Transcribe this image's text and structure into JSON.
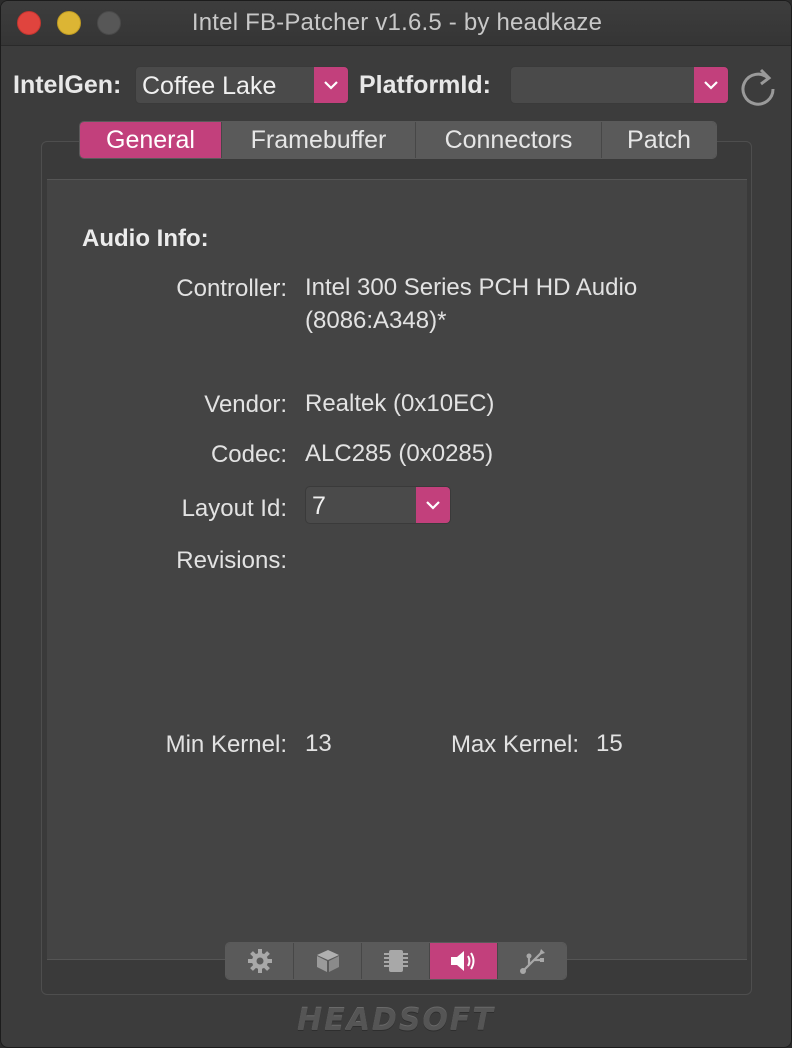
{
  "window": {
    "title": "Intel FB-Patcher v1.6.5 - by headkaze"
  },
  "toolbar": {
    "intelgen_label": "IntelGen:",
    "intelgen_value": "Coffee Lake",
    "platformid_label": "PlatformId:",
    "platformid_value": ""
  },
  "tabs": [
    {
      "label": "General",
      "active": true
    },
    {
      "label": "Framebuffer",
      "active": false
    },
    {
      "label": "Connectors",
      "active": false
    },
    {
      "label": "Patch",
      "active": false
    }
  ],
  "audio": {
    "heading": "Audio Info:",
    "controller_label": "Controller:",
    "controller_value_line1": "Intel 300 Series PCH HD Audio",
    "controller_value_line2": "(8086:A348)*",
    "vendor_label": "Vendor:",
    "vendor_value": "Realtek (0x10EC)",
    "codec_label": "Codec:",
    "codec_value": "ALC285 (0x0285)",
    "layout_label": "Layout Id:",
    "layout_value": "7",
    "revisions_label": "Revisions:",
    "min_kernel_label": "Min Kernel:",
    "min_kernel_value": "13",
    "max_kernel_label": "Max Kernel:",
    "max_kernel_value": "15"
  },
  "bottom_segments": [
    {
      "icon": "gear-icon",
      "active": false
    },
    {
      "icon": "box-icon",
      "active": false
    },
    {
      "icon": "chip-icon",
      "active": false
    },
    {
      "icon": "speaker-icon",
      "active": true
    },
    {
      "icon": "usb-icon",
      "active": false
    }
  ],
  "branding": {
    "logo": "HEADSOFT"
  },
  "colors": {
    "accent": "#c2407c",
    "window_bg": "#3c3c3c",
    "panel_bg": "#444444"
  }
}
